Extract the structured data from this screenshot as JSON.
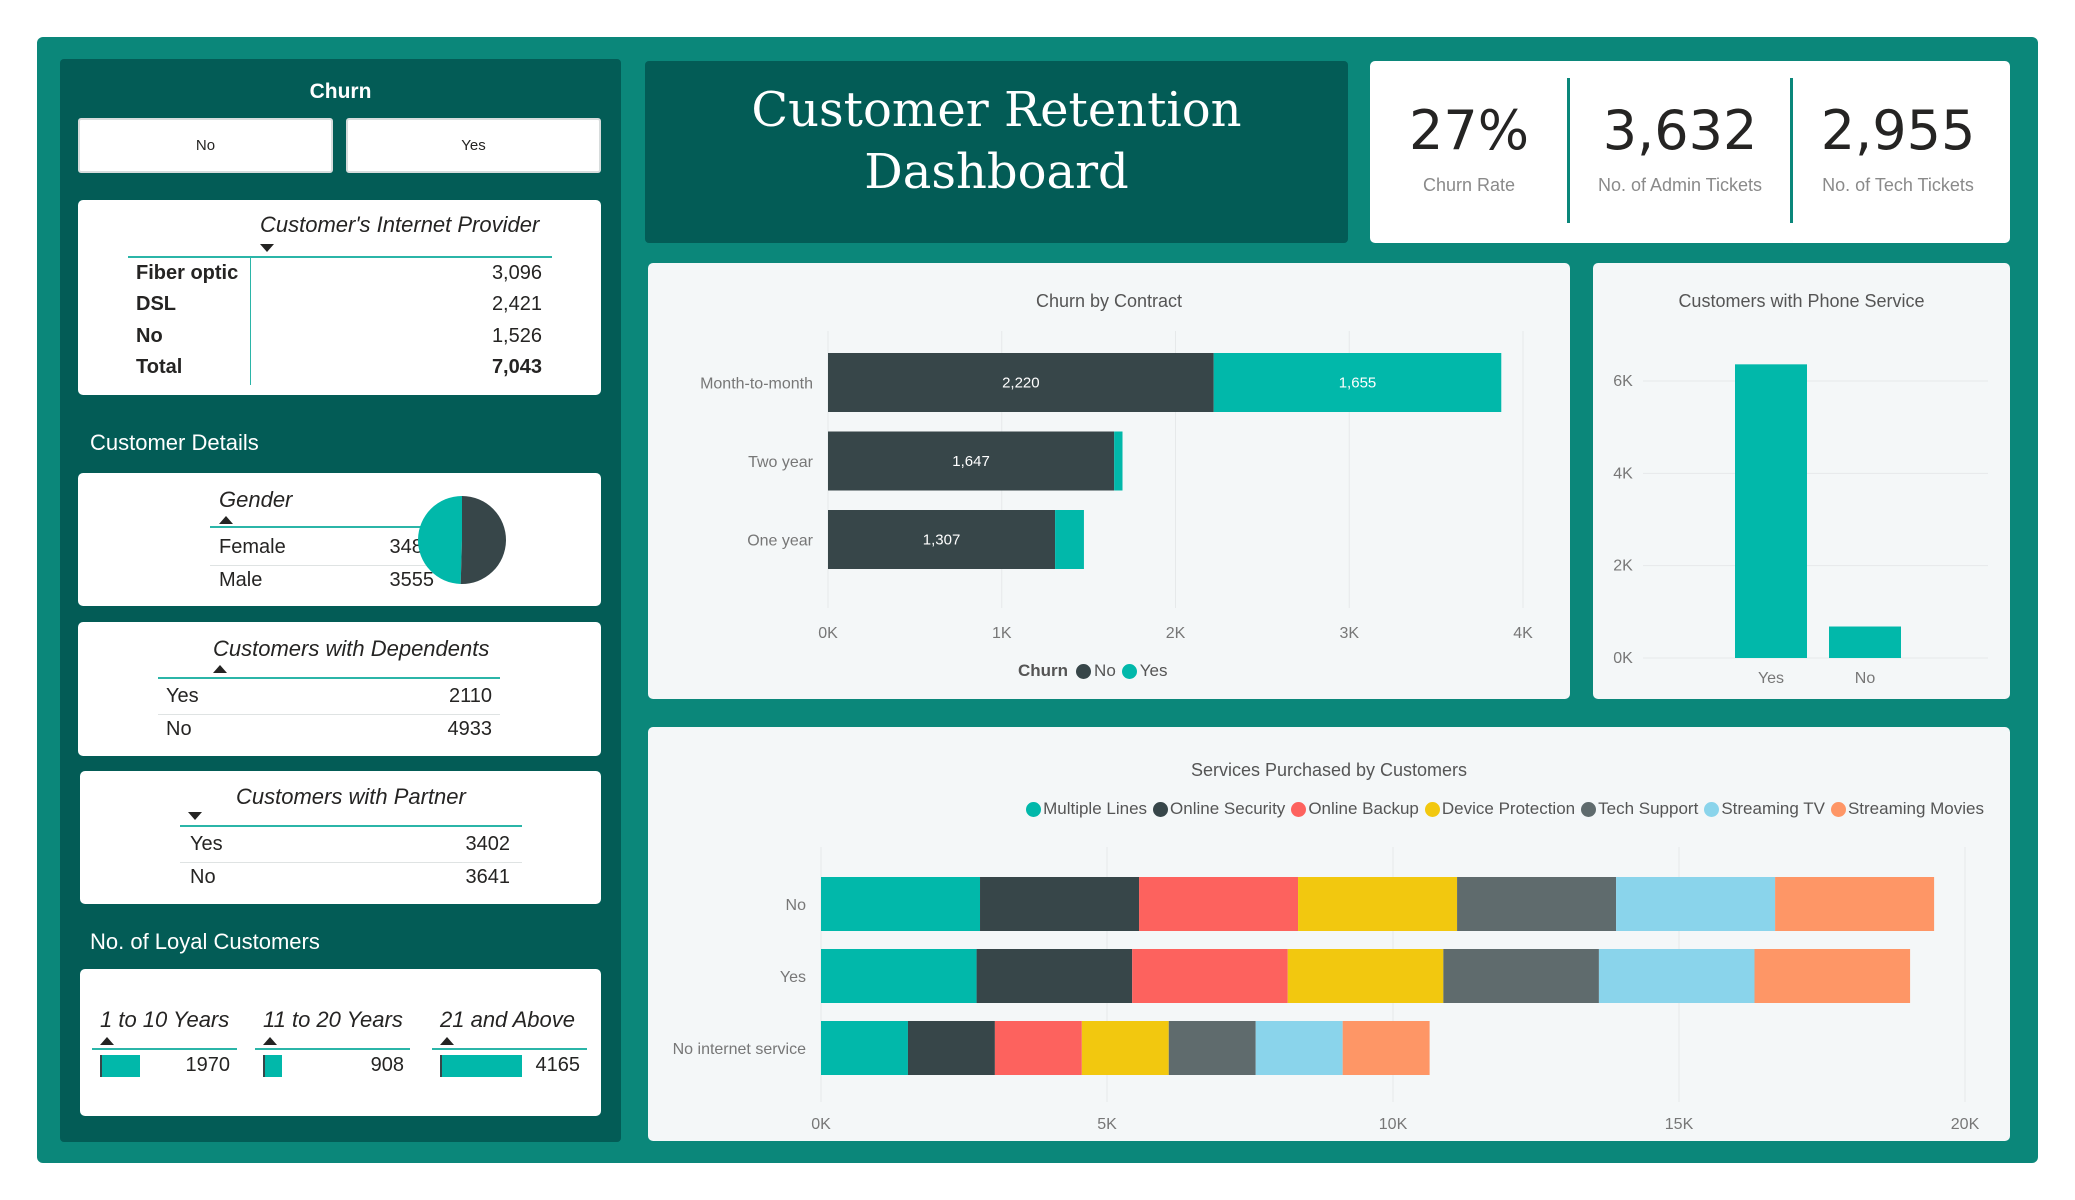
{
  "title": "Customer Retention Dashboard",
  "title_line1": "Customer Retention",
  "title_line2": "Dashboard",
  "colors": {
    "teal": "#01b8aa",
    "dark": "#374649",
    "frame": "#0b877a",
    "panel": "#035c56"
  },
  "churn_slicer": {
    "title": "Churn",
    "options": [
      "No",
      "Yes"
    ]
  },
  "internet_provider": {
    "header": "Customer's Internet Provider",
    "rows": [
      {
        "label": "Fiber optic",
        "value": "3,096"
      },
      {
        "label": "DSL",
        "value": "2,421"
      },
      {
        "label": "No",
        "value": "1,526"
      }
    ],
    "total_label": "Total",
    "total_value": "7,043"
  },
  "customer_details_label": "Customer Details",
  "gender": {
    "header": "Gender",
    "rows": [
      {
        "label": "Female",
        "value": "3488"
      },
      {
        "label": "Male",
        "value": "3555"
      }
    ]
  },
  "dependents": {
    "header": "Customers with Dependents",
    "rows": [
      {
        "label": "Yes",
        "value": "2110"
      },
      {
        "label": "No",
        "value": "4933"
      }
    ]
  },
  "partner": {
    "header": "Customers with Partner",
    "rows": [
      {
        "label": "Yes",
        "value": "3402"
      },
      {
        "label": "No",
        "value": "3641"
      }
    ]
  },
  "loyal_label": "No. of Loyal Customers",
  "loyal": [
    {
      "label": "1 to 10 Years",
      "value": "1970"
    },
    {
      "label": "11 to 20 Years",
      "value": "908"
    },
    {
      "label": "21 and Above",
      "value": "4165"
    }
  ],
  "kpis": [
    {
      "value": "27%",
      "label": "Churn Rate"
    },
    {
      "value": "3,632",
      "label": "No. of Admin Tickets"
    },
    {
      "value": "2,955",
      "label": "No. of Tech Tickets"
    }
  ],
  "chart_data": [
    {
      "type": "pie",
      "categories": [
        "Female",
        "Male"
      ],
      "values": [
        3488,
        3555
      ]
    },
    {
      "type": "bar",
      "orientation": "horizontal",
      "stacked": true,
      "title": "Churn by Contract",
      "categories": [
        "Month-to-month",
        "Two year",
        "One year"
      ],
      "series": [
        {
          "name": "No",
          "values": [
            2220,
            1647,
            1307
          ],
          "color": "#374649"
        },
        {
          "name": "Yes",
          "values": [
            1655,
            48,
            166
          ],
          "color": "#01b8aa"
        }
      ],
      "xlim": [
        0,
        4000
      ],
      "ticks": [
        "0K",
        "1K",
        "2K",
        "3K",
        "4K"
      ],
      "legend_title": "Churn",
      "legend_position": "bottom",
      "grid": true
    },
    {
      "type": "bar",
      "title": "Customers with Phone Service",
      "categories": [
        "Yes",
        "No"
      ],
      "values": [
        6361,
        682
      ],
      "color": "#01b8aa",
      "ylim": [
        0,
        6000
      ],
      "ticks": [
        "0K",
        "2K",
        "4K",
        "6K"
      ],
      "grid": true
    },
    {
      "type": "bar",
      "orientation": "horizontal",
      "stacked": true,
      "title": "Services Purchased by Customers",
      "categories": [
        "No",
        "Yes",
        "No internet service"
      ],
      "series": [
        {
          "name": "Multiple Lines",
          "values": [
            2780,
            2720,
            1520
          ],
          "color": "#01b8aa"
        },
        {
          "name": "Online Security",
          "values": [
            2780,
            2720,
            1520
          ],
          "color": "#374649"
        },
        {
          "name": "Online Backup",
          "values": [
            2780,
            2720,
            1520
          ],
          "color": "#fd625e"
        },
        {
          "name": "Device Protection",
          "values": [
            2780,
            2720,
            1520
          ],
          "color": "#f2c80f"
        },
        {
          "name": "Tech Support",
          "values": [
            2780,
            2720,
            1520
          ],
          "color": "#5f6b6d"
        },
        {
          "name": "Streaming TV",
          "values": [
            2780,
            2720,
            1520
          ],
          "color": "#8ad4eb"
        },
        {
          "name": "Streaming Movies",
          "values": [
            2780,
            2720,
            1520
          ],
          "color": "#fe9666"
        }
      ],
      "xlim": [
        0,
        20000
      ],
      "ticks": [
        "0K",
        "5K",
        "10K",
        "15K",
        "20K"
      ],
      "legend_position": "top-right",
      "grid": true
    }
  ]
}
